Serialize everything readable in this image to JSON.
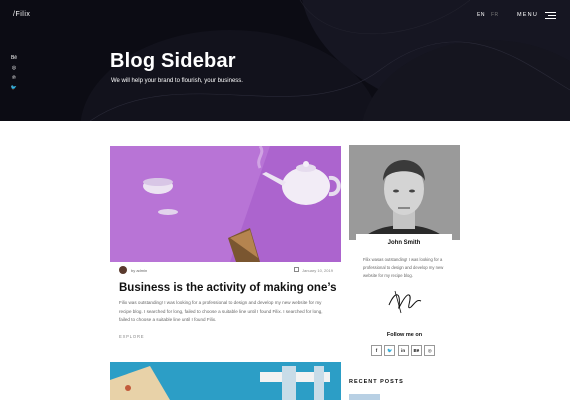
{
  "header": {
    "logo": "/Filix",
    "languages": [
      "EN",
      "FR"
    ],
    "menu_label": "MENU"
  },
  "side_social": [
    "Bē",
    "◎",
    "℗",
    "🐦"
  ],
  "hero": {
    "title": "Blog Sidebar",
    "subtitle": "We will help your brand to flourish, your business."
  },
  "post": {
    "byline": "by admin",
    "date": "January 10, 2019",
    "title": "Business is the activity of making one’s",
    "excerpt": "Filix was outstanding! I was looking for a professional to design and develop my new website for my recipe blog. I searched for long, failed to choose a suitable line until I found Filix. I searched for long, failed to choose a suitable line until I found Filix.",
    "cta": "EXPLORE"
  },
  "sidebar": {
    "author_name": "John Smith",
    "author_bio": "Filix wasas outstanding! I was looking for a professional to design and develop my new website for my recipe blog.",
    "follow_label": "Follow me on",
    "follow_icons": [
      "f",
      "🐦",
      "in",
      "Bē",
      "◎"
    ],
    "recent_posts_label": "RECENT POSTS"
  },
  "colors": {
    "hero_bg": "#0c0c14",
    "post_image_purple": "#b06bd0",
    "post_image2_blue": "#2a9cc4"
  }
}
